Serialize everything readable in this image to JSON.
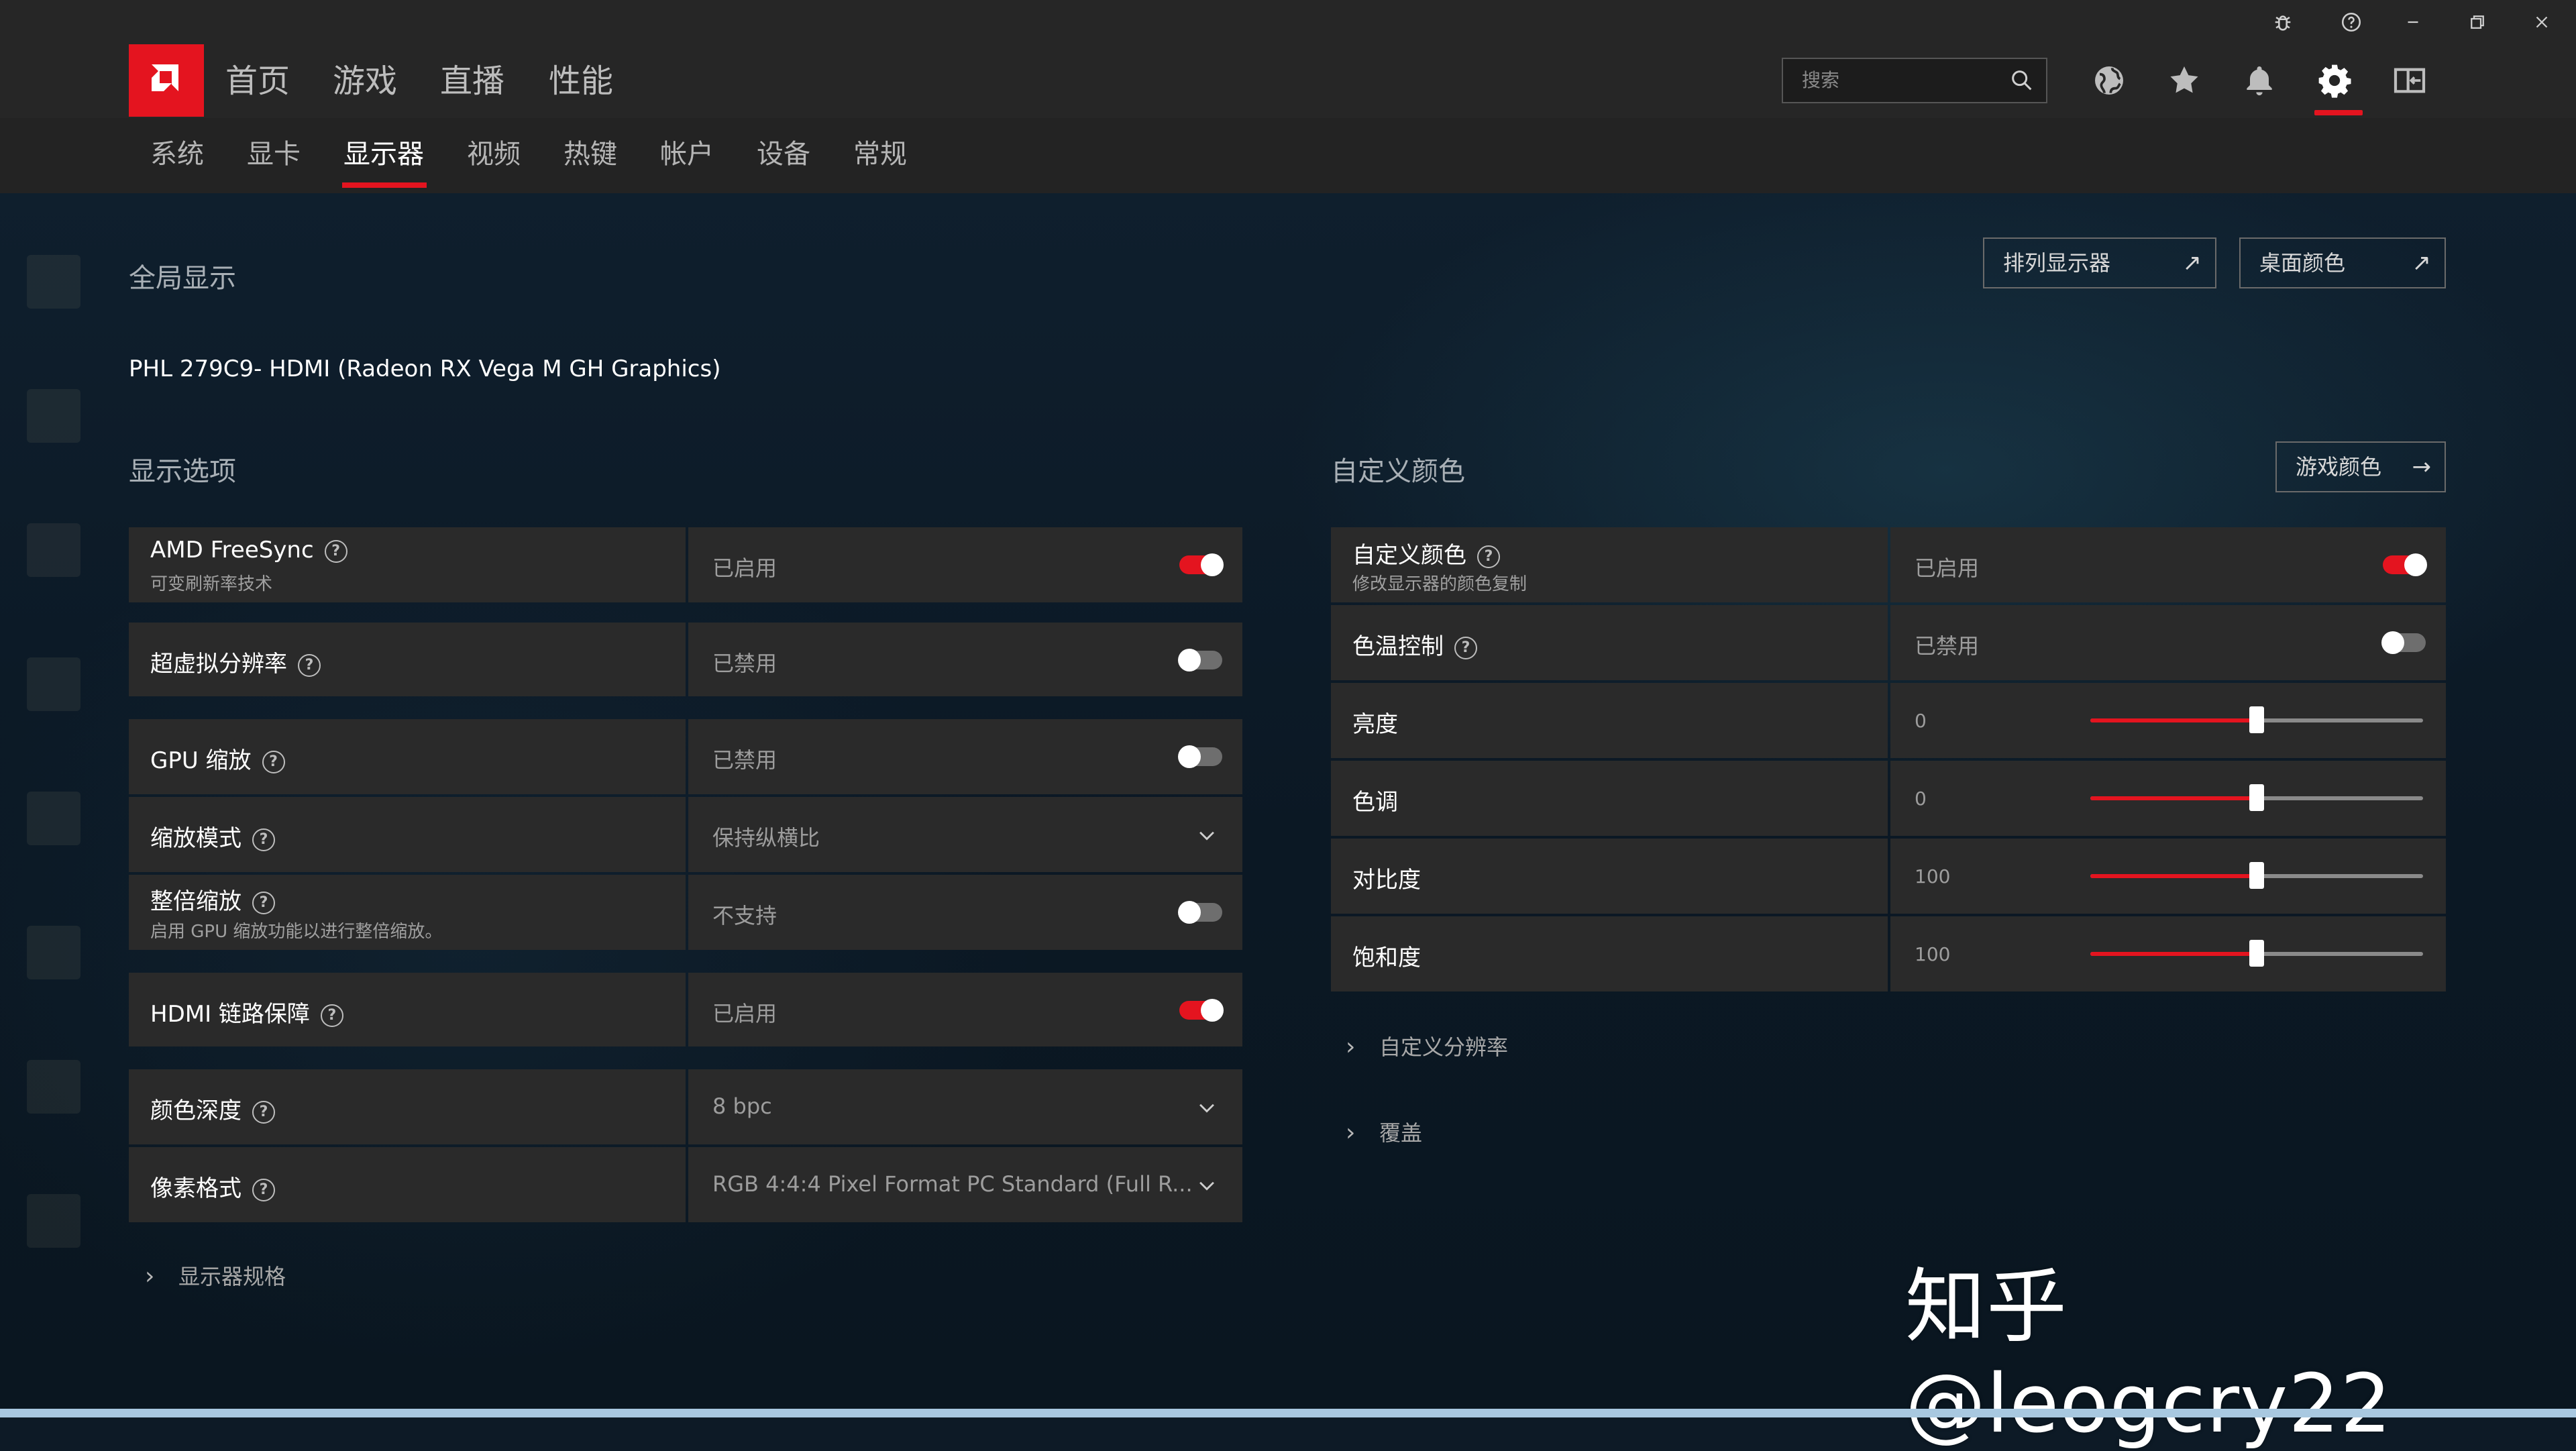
{
  "window": {
    "controls": [
      "bug",
      "help",
      "minimize",
      "restore",
      "close"
    ]
  },
  "nav": {
    "main": [
      "首页",
      "游戏",
      "直播",
      "性能"
    ]
  },
  "search": {
    "placeholder": "搜索"
  },
  "header_icons": [
    "globe-icon",
    "star-icon",
    "bell-icon",
    "gear-icon",
    "sidebar-icon"
  ],
  "subnav": {
    "items": [
      "系统",
      "显卡",
      "显示器",
      "视频",
      "热键",
      "帐户",
      "设备",
      "常规"
    ],
    "active": "显示器"
  },
  "global_display": {
    "title": "全局显示",
    "arrange_button": "排列显示器",
    "desktop_color_button": "桌面颜色",
    "monitor_name": "PHL 279C9- HDMI (Radeon RX Vega M GH Graphics)"
  },
  "display_options": {
    "title": "显示选项",
    "rows": [
      {
        "label": "AMD FreeSync",
        "sub": "可变刷新率技术",
        "value": "已启用",
        "control": "toggle",
        "on": true
      },
      {
        "label": "超虚拟分辨率",
        "value": "已禁用",
        "control": "toggle",
        "on": false
      },
      {
        "label": "GPU 缩放",
        "value": "已禁用",
        "control": "toggle",
        "on": false
      },
      {
        "label": "缩放模式",
        "value": "保持纵横比",
        "control": "dropdown"
      },
      {
        "label": "整倍缩放",
        "sub": "启用 GPU 缩放功能以进行整倍缩放。",
        "value": "不支持",
        "control": "toggle",
        "on": false
      },
      {
        "label": "HDMI 链路保障",
        "value": "已启用",
        "control": "toggle",
        "on": true
      },
      {
        "label": "颜色深度",
        "value": "8 bpc",
        "control": "dropdown"
      },
      {
        "label": "像素格式",
        "value": "RGB 4:4:4 Pixel Format PC Standard (Full R...",
        "control": "dropdown"
      }
    ],
    "specs_expander": "显示器规格"
  },
  "custom_color": {
    "title": "自定义颜色",
    "game_color_button": "游戏颜色",
    "rows": [
      {
        "label": "自定义颜色",
        "sub": "修改显示器的颜色复制",
        "value": "已启用",
        "control": "toggle",
        "on": true
      },
      {
        "label": "色温控制",
        "value": "已禁用",
        "control": "toggle",
        "on": false
      },
      {
        "label": "亮度",
        "value": "0",
        "control": "slider",
        "level": 0.5
      },
      {
        "label": "色调",
        "value": "0",
        "control": "slider",
        "level": 0.5
      },
      {
        "label": "对比度",
        "value": "100",
        "control": "slider",
        "level": 0.5
      },
      {
        "label": "饱和度",
        "value": "100",
        "control": "slider",
        "level": 0.5
      }
    ],
    "expanders": [
      "自定义分辨率",
      "覆盖"
    ]
  },
  "watermark": "知乎 @leogcry22",
  "colors": {
    "accent": "#e4141f",
    "panel": "#2a2a2a",
    "header": "#262626",
    "background": "#0d1a26"
  }
}
